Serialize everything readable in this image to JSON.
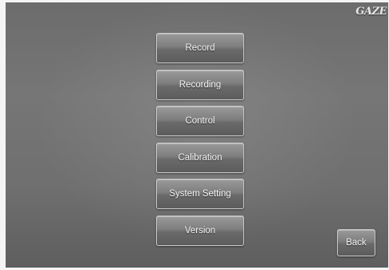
{
  "logo": {
    "text": "GAZE"
  },
  "menu": {
    "items": [
      {
        "label": "Record"
      },
      {
        "label": "Recording"
      },
      {
        "label": "Control"
      },
      {
        "label": "Calibration"
      },
      {
        "label": "System Setting"
      },
      {
        "label": "Version"
      }
    ]
  },
  "footer": {
    "back_label": "Back"
  }
}
